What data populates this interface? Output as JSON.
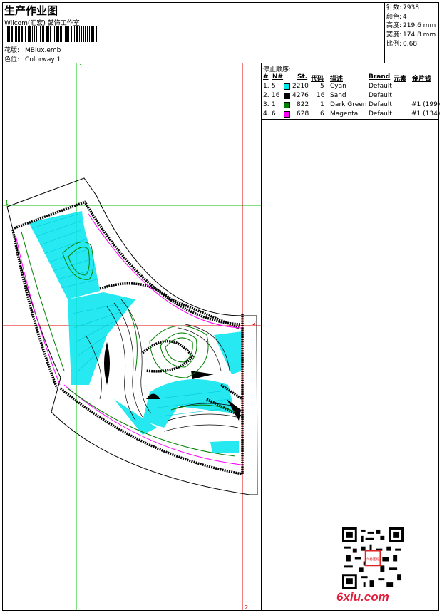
{
  "header": {
    "title": "生产作业图",
    "company": "Wilcom(汇宏) 鼓饰工作室",
    "design_label": "花版:",
    "design_value": "MBiux.emb",
    "colorway_label": "色位:",
    "colorway_value": "Colorway 1"
  },
  "stats": [
    {
      "label": "针数:",
      "value": "7938"
    },
    {
      "label": "颜色:",
      "value": "4"
    },
    {
      "label": "高度:",
      "value": "219.6 mm"
    },
    {
      "label": "宽度:",
      "value": "174.8 mm"
    },
    {
      "label": "比例:",
      "value": "0.68"
    }
  ],
  "sequence": {
    "title": "停止顺序:",
    "headers": {
      "index": "#",
      "no": "N#",
      "stitches": "St.",
      "code": "代码",
      "desc": "描述",
      "brand": "Brand",
      "element": "元素",
      "sequin": "金片钱"
    },
    "rows": [
      {
        "index": "1.",
        "no": "5",
        "color": "#00e5ee",
        "stitches": "2210",
        "code": "5",
        "desc": "Cyan",
        "brand": "Default",
        "sequin": ""
      },
      {
        "index": "2.",
        "no": "16",
        "color": "#000000",
        "stitches": "4276",
        "code": "16",
        "desc": "Sand",
        "brand": "Default",
        "sequin": ""
      },
      {
        "index": "3.",
        "no": "1",
        "color": "#008000",
        "stitches": "822",
        "code": "1",
        "desc": "Dark Green",
        "brand": "Default",
        "sequin": "#1 (199)"
      },
      {
        "index": "4.",
        "no": "6",
        "color": "#ff00ff",
        "stitches": "628",
        "code": "6",
        "desc": "Magenta",
        "brand": "Default",
        "sequin": "#1 (134)"
      }
    ]
  },
  "guides": {
    "green_v_label": "1",
    "green_h_label": "1",
    "red_h_label": "2",
    "red_v_label": "2"
  },
  "watermark": {
    "text": "6xiu.com",
    "seal": "六秀图纸"
  },
  "colors": {
    "cyan": "#00e5ee",
    "green": "#00c000",
    "red": "#e00000",
    "magenta": "#ff00ff",
    "dark_green": "#008000"
  }
}
